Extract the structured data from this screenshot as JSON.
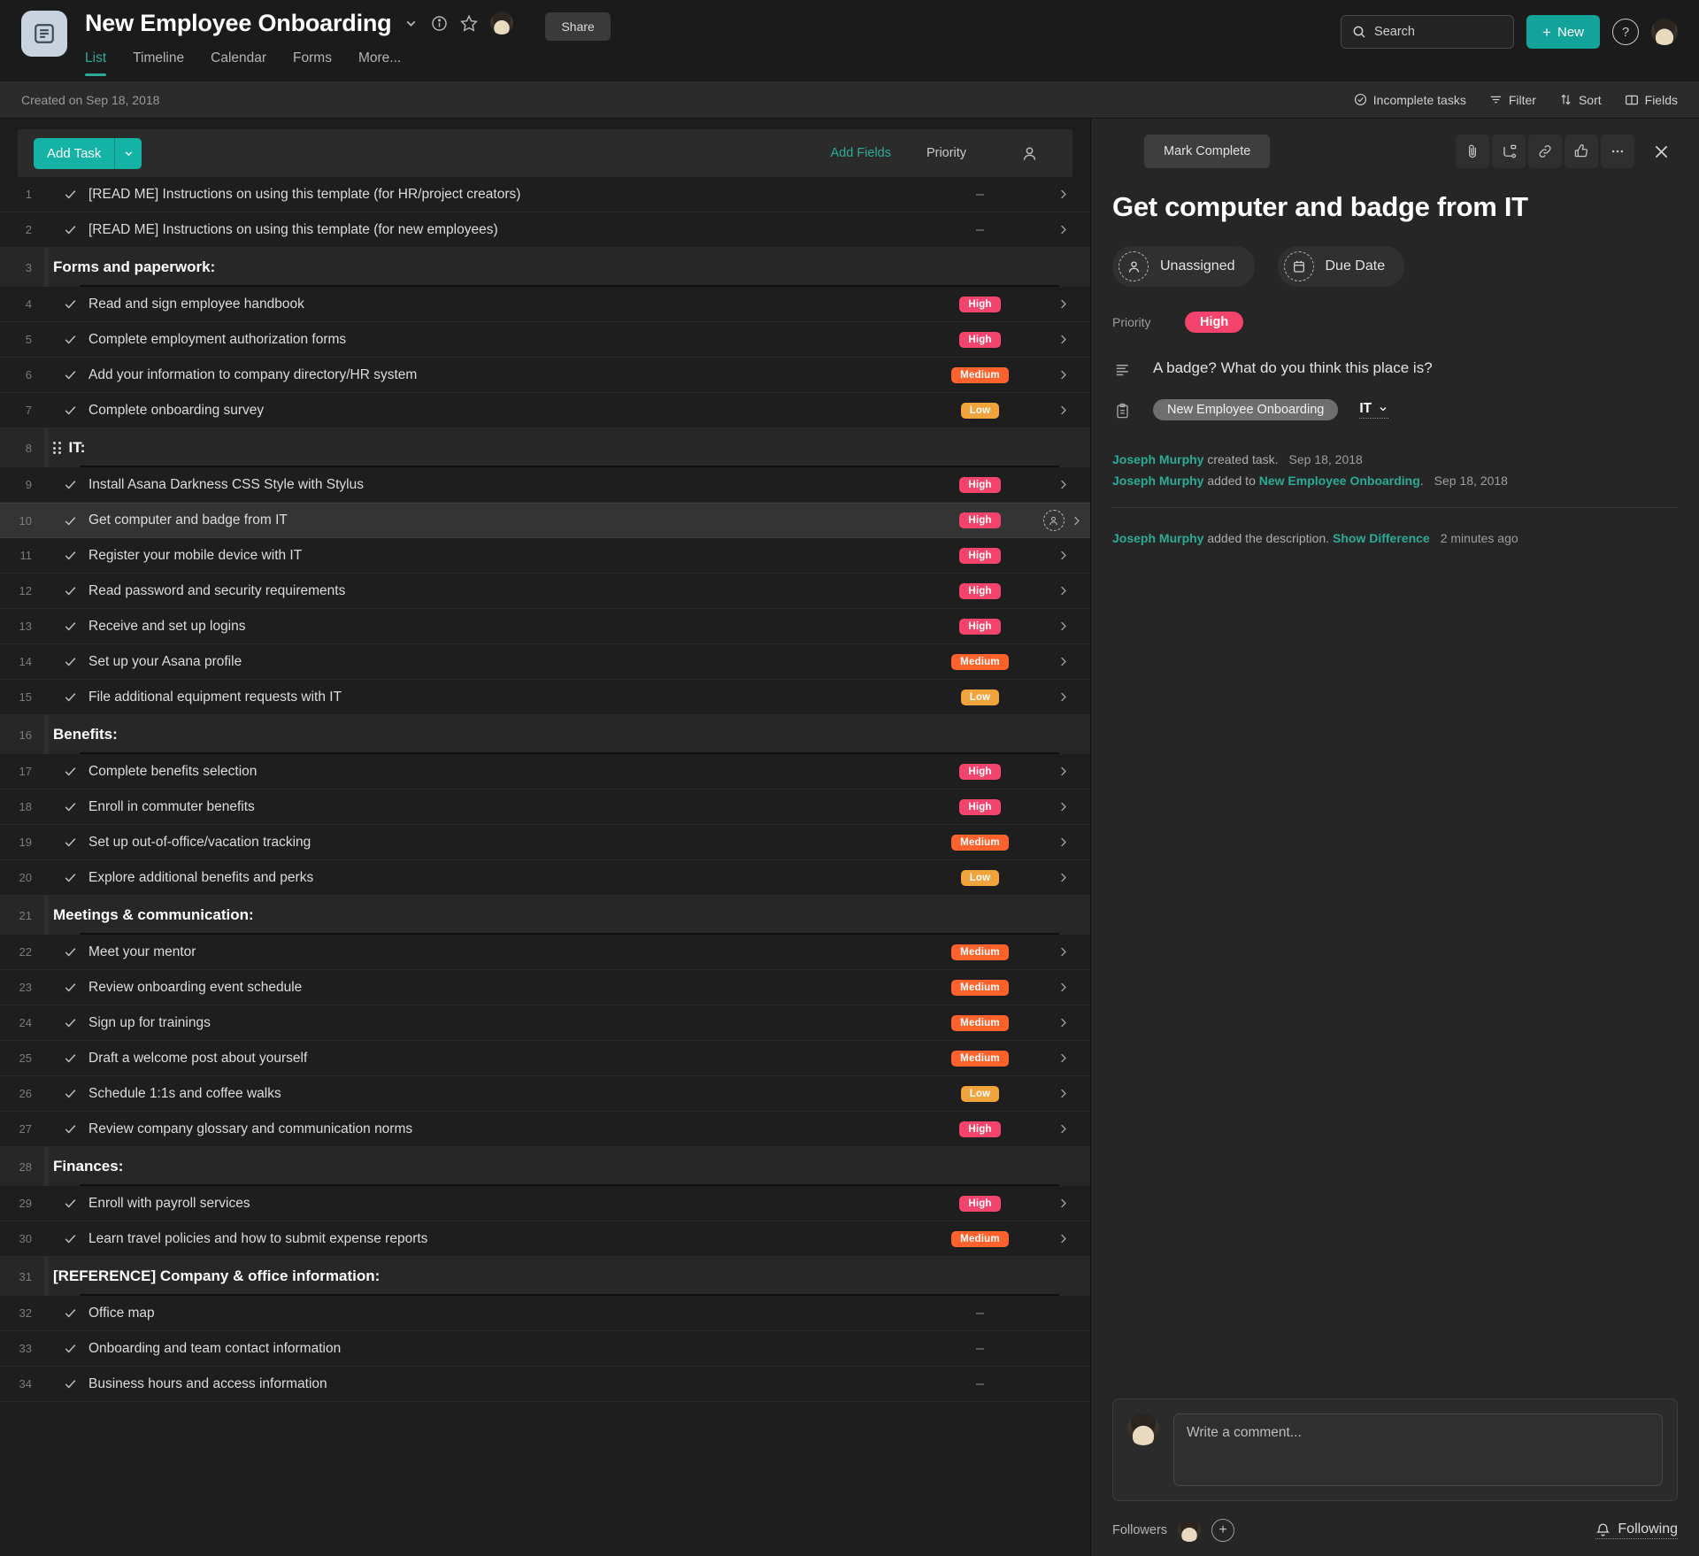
{
  "header": {
    "project_icon": "list-project-icon",
    "project_title": "New Employee Onboarding",
    "share_label": "Share",
    "tabs": [
      {
        "label": "List",
        "active": true
      },
      {
        "label": "Timeline",
        "active": false
      },
      {
        "label": "Calendar",
        "active": false
      },
      {
        "label": "Forms",
        "active": false
      },
      {
        "label": "More...",
        "active": false
      }
    ],
    "search_placeholder": "Search",
    "new_label": "New",
    "help_label": "?"
  },
  "subbar": {
    "created_text": "Created on Sep 18, 2018",
    "actions": [
      {
        "label": "Incomplete tasks",
        "icon": "check-circle-icon"
      },
      {
        "label": "Filter",
        "icon": "filter-icon"
      },
      {
        "label": "Sort",
        "icon": "sort-icon"
      },
      {
        "label": "Fields",
        "icon": "fields-icon"
      }
    ]
  },
  "list_toolbar": {
    "add_task_label": "Add Task",
    "add_fields_label": "Add Fields",
    "priority_column_label": "Priority",
    "assignee_column_icon": "person-icon"
  },
  "rows": [
    {
      "num": "1",
      "type": "task",
      "text": "[READ ME] Instructions on using this template (for HR/project creators)",
      "priority": "",
      "dash": true
    },
    {
      "num": "2",
      "type": "task",
      "text": "[READ ME] Instructions on using this template (for new employees)",
      "priority": "",
      "dash": true
    },
    {
      "num": "3",
      "type": "section",
      "text": "Forms and paperwork:",
      "grip": false
    },
    {
      "num": "4",
      "type": "task",
      "text": "Read and sign employee handbook",
      "priority": "High"
    },
    {
      "num": "5",
      "type": "task",
      "text": "Complete employment authorization forms",
      "priority": "High"
    },
    {
      "num": "6",
      "type": "task",
      "text": "Add your information to company directory/HR system",
      "priority": "Medium"
    },
    {
      "num": "7",
      "type": "task",
      "text": "Complete onboarding survey",
      "priority": "Low"
    },
    {
      "num": "8",
      "type": "section",
      "text": "IT:",
      "grip": true
    },
    {
      "num": "9",
      "type": "task",
      "text": "Install Asana Darkness CSS Style with Stylus",
      "priority": "High"
    },
    {
      "num": "10",
      "type": "task",
      "text": "Get computer and badge from IT",
      "priority": "High",
      "selected": true,
      "assignee_placeholder": true
    },
    {
      "num": "11",
      "type": "task",
      "text": "Register your mobile device with IT",
      "priority": "High"
    },
    {
      "num": "12",
      "type": "task",
      "text": "Read password and security requirements",
      "priority": "High"
    },
    {
      "num": "13",
      "type": "task",
      "text": "Receive and set up logins",
      "priority": "High"
    },
    {
      "num": "14",
      "type": "task",
      "text": "Set up your Asana profile",
      "priority": "Medium"
    },
    {
      "num": "15",
      "type": "task",
      "text": "File additional equipment requests with IT",
      "priority": "Low"
    },
    {
      "num": "16",
      "type": "section",
      "text": "Benefits:",
      "grip": false
    },
    {
      "num": "17",
      "type": "task",
      "text": "Complete benefits selection",
      "priority": "High"
    },
    {
      "num": "18",
      "type": "task",
      "text": "Enroll in commuter benefits",
      "priority": "High"
    },
    {
      "num": "19",
      "type": "task",
      "text": "Set up out-of-office/vacation tracking",
      "priority": "Medium"
    },
    {
      "num": "20",
      "type": "task",
      "text": "Explore additional benefits and perks",
      "priority": "Low"
    },
    {
      "num": "21",
      "type": "section",
      "text": "Meetings & communication:",
      "grip": false
    },
    {
      "num": "22",
      "type": "task",
      "text": "Meet your mentor",
      "priority": "Medium"
    },
    {
      "num": "23",
      "type": "task",
      "text": "Review onboarding event schedule",
      "priority": "Medium"
    },
    {
      "num": "24",
      "type": "task",
      "text": "Sign up for trainings",
      "priority": "Medium"
    },
    {
      "num": "25",
      "type": "task",
      "text": "Draft a welcome post about yourself",
      "priority": "Medium"
    },
    {
      "num": "26",
      "type": "task",
      "text": "Schedule 1:1s and coffee walks",
      "priority": "Low"
    },
    {
      "num": "27",
      "type": "task",
      "text": "Review company glossary and communication norms",
      "priority": "High"
    },
    {
      "num": "28",
      "type": "section",
      "text": "Finances:",
      "grip": false
    },
    {
      "num": "29",
      "type": "task",
      "text": "Enroll with payroll services",
      "priority": "High"
    },
    {
      "num": "30",
      "type": "task",
      "text": "Learn travel policies and how to submit expense reports",
      "priority": "Medium"
    },
    {
      "num": "31",
      "type": "section",
      "text": "[REFERENCE] Company & office information:",
      "grip": false
    },
    {
      "num": "32",
      "type": "task",
      "text": "Office map",
      "priority": "",
      "dash": true,
      "no_chevron": true
    },
    {
      "num": "33",
      "type": "task",
      "text": "Onboarding and team contact information",
      "priority": "",
      "dash": true,
      "no_chevron": true
    },
    {
      "num": "34",
      "type": "task",
      "text": "Business hours and access information",
      "priority": "",
      "dash": true,
      "no_chevron": true
    }
  ],
  "detail": {
    "mark_complete_label": "Mark Complete",
    "head_icons": [
      "attachment-icon",
      "subtask-icon",
      "link-icon",
      "thumbs-up-icon",
      "more-icon",
      "close-icon"
    ],
    "task_title": "Get computer and badge from IT",
    "assignee_label": "Unassigned",
    "due_date_label": "Due Date",
    "priority_label": "Priority",
    "priority_value": "High",
    "description": "A badge? What do you think this place is?",
    "project_tag": "New Employee Onboarding",
    "section_name": "IT",
    "activity": [
      {
        "who": "Joseph Murphy",
        "action": " created task.",
        "link": "",
        "after": "",
        "when": "Sep 18, 2018"
      },
      {
        "who": "Joseph Murphy",
        "action": " added to ",
        "link": "New Employee Onboarding",
        "after": ".",
        "when": "Sep 18, 2018"
      }
    ],
    "activity_recent": {
      "who": "Joseph Murphy",
      "action": " added the description. ",
      "link": "Show Difference",
      "after": "",
      "when": "2 minutes ago"
    },
    "comment_placeholder": "Write a comment...",
    "followers_label": "Followers",
    "following_label": "Following"
  },
  "colors": {
    "accent": "#2aab96",
    "new_button": "#12a39b",
    "high": "#f4436c",
    "medium": "#fd612c",
    "low": "#f1a33c"
  }
}
